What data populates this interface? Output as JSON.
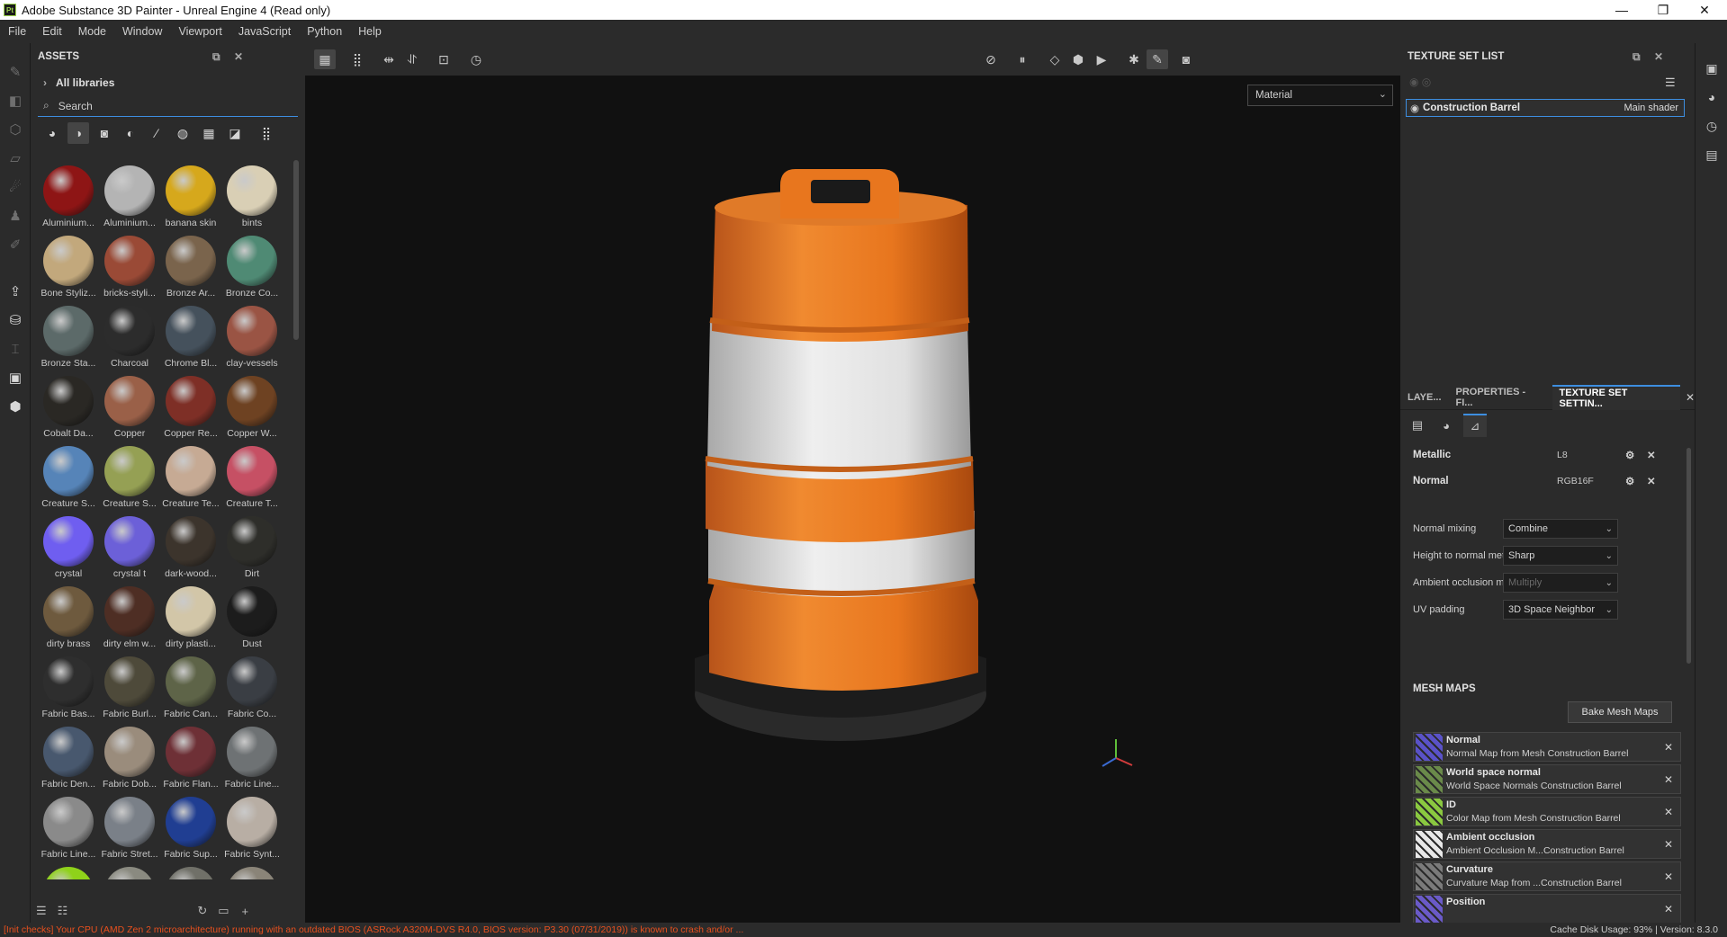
{
  "window": {
    "title": "Adobe Substance 3D Painter - Unreal Engine 4 (Read only)",
    "app_badge": "Pt",
    "controls": {
      "minimize": "—",
      "maximize": "❐",
      "close": "✕"
    }
  },
  "menu": [
    "File",
    "Edit",
    "Mode",
    "Window",
    "Viewport",
    "JavaScript",
    "Python",
    "Help"
  ],
  "assets": {
    "title": "ASSETS",
    "libraries_label": "All libraries",
    "search_value": "Search",
    "items": [
      {
        "name": "Aluminium...",
        "color": "#8e1515"
      },
      {
        "name": "Aluminium...",
        "color": "#b4b4b4"
      },
      {
        "name": "banana skin",
        "color": "#d6a81c"
      },
      {
        "name": "bints",
        "color": "#d9cfb5"
      },
      {
        "name": "Bone Styliz...",
        "color": "#c2a87c"
      },
      {
        "name": "bricks-styli...",
        "color": "#9a4a36"
      },
      {
        "name": "Bronze Ar...",
        "color": "#7a644c"
      },
      {
        "name": "Bronze Co...",
        "color": "#4f8a74"
      },
      {
        "name": "Bronze Sta...",
        "color": "#5c6a69"
      },
      {
        "name": "Charcoal",
        "color": "#2c2c2c"
      },
      {
        "name": "Chrome Bl...",
        "color": "#45515c"
      },
      {
        "name": "clay-vessels",
        "color": "#9a5444"
      },
      {
        "name": "Cobalt Da...",
        "color": "#2a2824"
      },
      {
        "name": "Copper",
        "color": "#9a6048"
      },
      {
        "name": "Copper Re...",
        "color": "#7e2f26"
      },
      {
        "name": "Copper W...",
        "color": "#6e4222"
      },
      {
        "name": "Creature S...",
        "color": "#5684b8"
      },
      {
        "name": "Creature S...",
        "color": "#95a054"
      },
      {
        "name": "Creature Te...",
        "color": "#c6aa94"
      },
      {
        "name": "Creature T...",
        "color": "#c65064"
      },
      {
        "name": "crystal",
        "color": "#6f5ef0"
      },
      {
        "name": "crystal t",
        "color": "#6c60d8"
      },
      {
        "name": "dark-wood...",
        "color": "#3c342c"
      },
      {
        "name": "Dirt",
        "color": "#2e2e2a"
      },
      {
        "name": "dirty brass",
        "color": "#6e5a3e"
      },
      {
        "name": "dirty elm w...",
        "color": "#4e2e24"
      },
      {
        "name": "dirty plasti...",
        "color": "#d2c6a8"
      },
      {
        "name": "Dust",
        "color": "#1c1c1c"
      },
      {
        "name": "Fabric Bas...",
        "color": "#2e2e2e"
      },
      {
        "name": "Fabric Burl...",
        "color": "#4e4a3a"
      },
      {
        "name": "Fabric Can...",
        "color": "#5e6448"
      },
      {
        "name": "Fabric Co...",
        "color": "#3a3e44"
      },
      {
        "name": "Fabric Den...",
        "color": "#48586e"
      },
      {
        "name": "Fabric Dob...",
        "color": "#9a8c7c"
      },
      {
        "name": "Fabric Flan...",
        "color": "#6e3036"
      },
      {
        "name": "Fabric Line...",
        "color": "#6e7274"
      },
      {
        "name": "Fabric Line...",
        "color": "#8a8a8a"
      },
      {
        "name": "Fabric Stret...",
        "color": "#7a8088"
      },
      {
        "name": "Fabric Sup...",
        "color": "#203e92"
      },
      {
        "name": "Fabric Synt...",
        "color": "#b8aea4"
      },
      {
        "name": "",
        "color": "#8fd21a"
      },
      {
        "name": "",
        "color": "#8a8a80"
      },
      {
        "name": "",
        "color": "#707068"
      },
      {
        "name": "",
        "color": "#8a8478"
      }
    ]
  },
  "viewport": {
    "material_select": "Material"
  },
  "texture_set_list": {
    "title": "TEXTURE SET LIST",
    "item_name": "Construction Barrel",
    "item_shader": "Main shader"
  },
  "tabs": [
    "LAYE...",
    "PROPERTIES - FI...",
    "TEXTURE SET SETTIN..."
  ],
  "channels": [
    {
      "name": "Metallic",
      "format": "L8"
    },
    {
      "name": "Normal",
      "format": "RGB16F"
    }
  ],
  "properties": [
    {
      "label": "Normal mixing",
      "value": "Combine",
      "disabled": false
    },
    {
      "label": "Height to normal method",
      "value": "Sharp",
      "disabled": false
    },
    {
      "label": "Ambient occlusion mixing",
      "value": "Multiply",
      "disabled": true
    },
    {
      "label": "UV padding",
      "value": "3D Space Neighbor",
      "disabled": false
    }
  ],
  "mesh_maps": {
    "title": "MESH MAPS",
    "bake_button": "Bake Mesh Maps",
    "items": [
      {
        "name": "Normal",
        "desc": "Normal Map from Mesh Construction Barrel",
        "thumb": "#5a52c8"
      },
      {
        "name": "World space normal",
        "desc": "World Space Normals Construction Barrel",
        "thumb": "#6a8a4a"
      },
      {
        "name": "ID",
        "desc": "Color Map from Mesh Construction Barrel",
        "thumb": "#8ac840"
      },
      {
        "name": "Ambient occlusion",
        "desc": "Ambient Occlusion M...Construction Barrel",
        "thumb": "#e8e8e8"
      },
      {
        "name": "Curvature",
        "desc": "Curvature Map from ...Construction Barrel",
        "thumb": "#7a7a7a"
      },
      {
        "name": "Position",
        "desc": "",
        "thumb": "#6a5ac8"
      }
    ]
  },
  "status": {
    "warning": "[Init checks] Your CPU (AMD Zen 2 microarchitecture) running with an outdated BIOS (ASRock A320M-DVS R4.0, BIOS version: P3.30 (07/31/2019)) is known to crash and/or ...",
    "cache": "Cache Disk Usage:   93%  |  Version: 8.3.0"
  },
  "colors": {
    "accent": "#3d8ee0",
    "barrel_orange": "#e8761e",
    "barrel_white": "#e6e6e6",
    "warning": "#e8501e"
  }
}
